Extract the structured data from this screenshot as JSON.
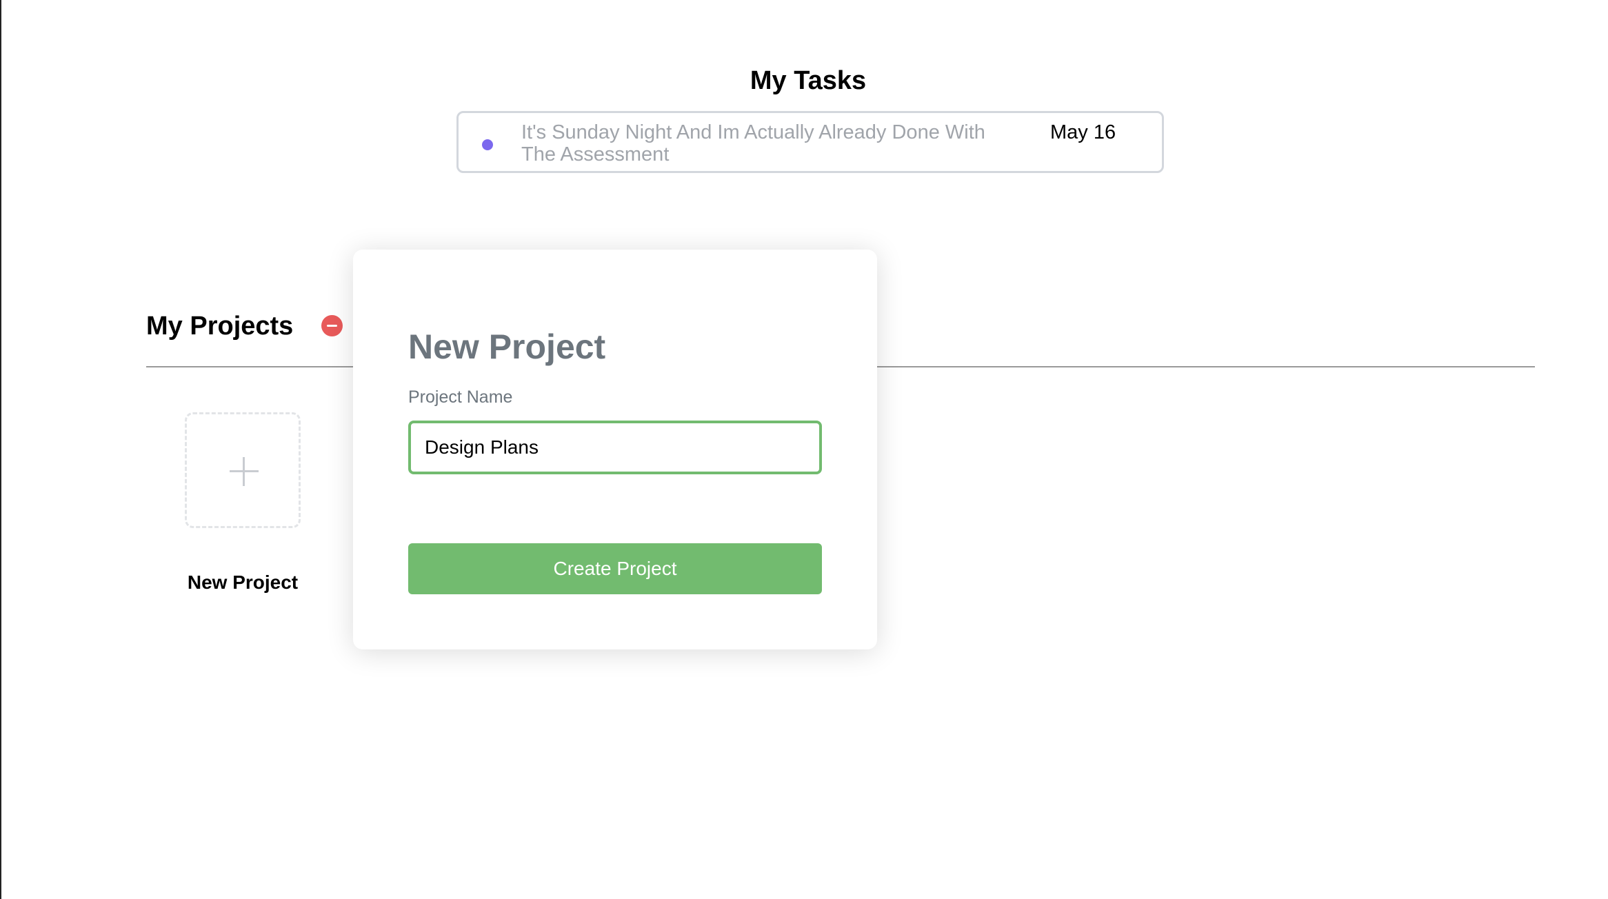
{
  "tasks": {
    "title": "My Tasks",
    "items": [
      {
        "text": "It's Sunday Night And Im Actually Already Done With The Assessment",
        "date": "May 16",
        "dot_color": "#7b68ee"
      }
    ]
  },
  "projects": {
    "title": "My Projects",
    "remove_icon_color": "#e85a5a",
    "new_tile_label": "New Project"
  },
  "modal": {
    "title": "New Project",
    "field_label": "Project Name",
    "input_value": "Design Plans",
    "create_button_label": "Create Project",
    "accent": "#72bb6f"
  }
}
